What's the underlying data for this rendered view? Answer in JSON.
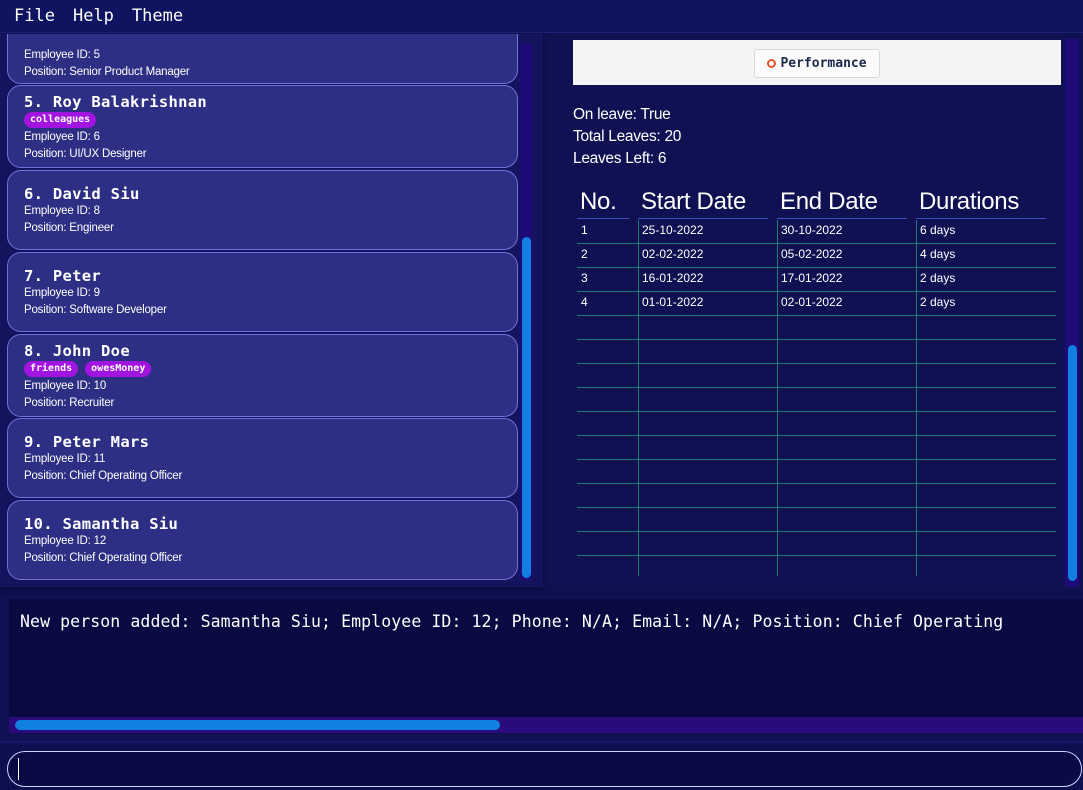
{
  "menu": {
    "items": [
      "File",
      "Help",
      "Theme"
    ]
  },
  "people": [
    {
      "name": "",
      "tags": [],
      "employee_id": "Employee ID: 5",
      "position": "Position: Senior Product Manager"
    },
    {
      "name": "5.  Roy Balakrishnan",
      "tags": [
        "colleagues"
      ],
      "employee_id": "Employee ID: 6",
      "position": "Position: UI/UX Designer"
    },
    {
      "name": "6.  David  Siu",
      "tags": [],
      "employee_id": "Employee ID: 8",
      "position": "Position: Engineer"
    },
    {
      "name": "7.  Peter",
      "tags": [],
      "employee_id": "Employee ID: 9",
      "position": "Position: Software Developer"
    },
    {
      "name": "8.  John Doe",
      "tags": [
        "friends",
        "owesMoney"
      ],
      "employee_id": "Employee ID: 10",
      "position": "Position: Recruiter"
    },
    {
      "name": "9.  Peter Mars",
      "tags": [],
      "employee_id": "Employee ID: 11",
      "position": "Position: Chief Operating Officer"
    },
    {
      "name": "10.  Samantha Siu",
      "tags": [],
      "employee_id": "Employee ID: 12",
      "position": "Position: Chief Operating Officer"
    }
  ],
  "details": {
    "tab_label": "Performance",
    "on_leave": "On leave: True",
    "total_leaves": "Total Leaves: 20",
    "leaves_left": "Leaves Left: 6"
  },
  "leave_table": {
    "headers": [
      "No.",
      "Start Date",
      "End Date",
      "Durations"
    ],
    "rows": [
      [
        "1",
        "25-10-2022",
        "30-10-2022",
        "6 days"
      ],
      [
        "2",
        "02-02-2022",
        "05-02-2022",
        "4 days"
      ],
      [
        "3",
        "16-01-2022",
        "17-01-2022",
        "2 days"
      ],
      [
        "4",
        "01-01-2022",
        "02-01-2022",
        "2 days"
      ]
    ]
  },
  "result": {
    "message": "New person added: Samantha Siu; Employee ID: 12; Phone: N/A; Email: N/A; Position: Chief Operating"
  },
  "command": {
    "value": ""
  },
  "colors": {
    "background": "#0d0f4e",
    "card": "#2d2f85",
    "tag": "#a214e0",
    "scroll_thumb": "#1180e0",
    "grid": "#1b7d6a"
  }
}
